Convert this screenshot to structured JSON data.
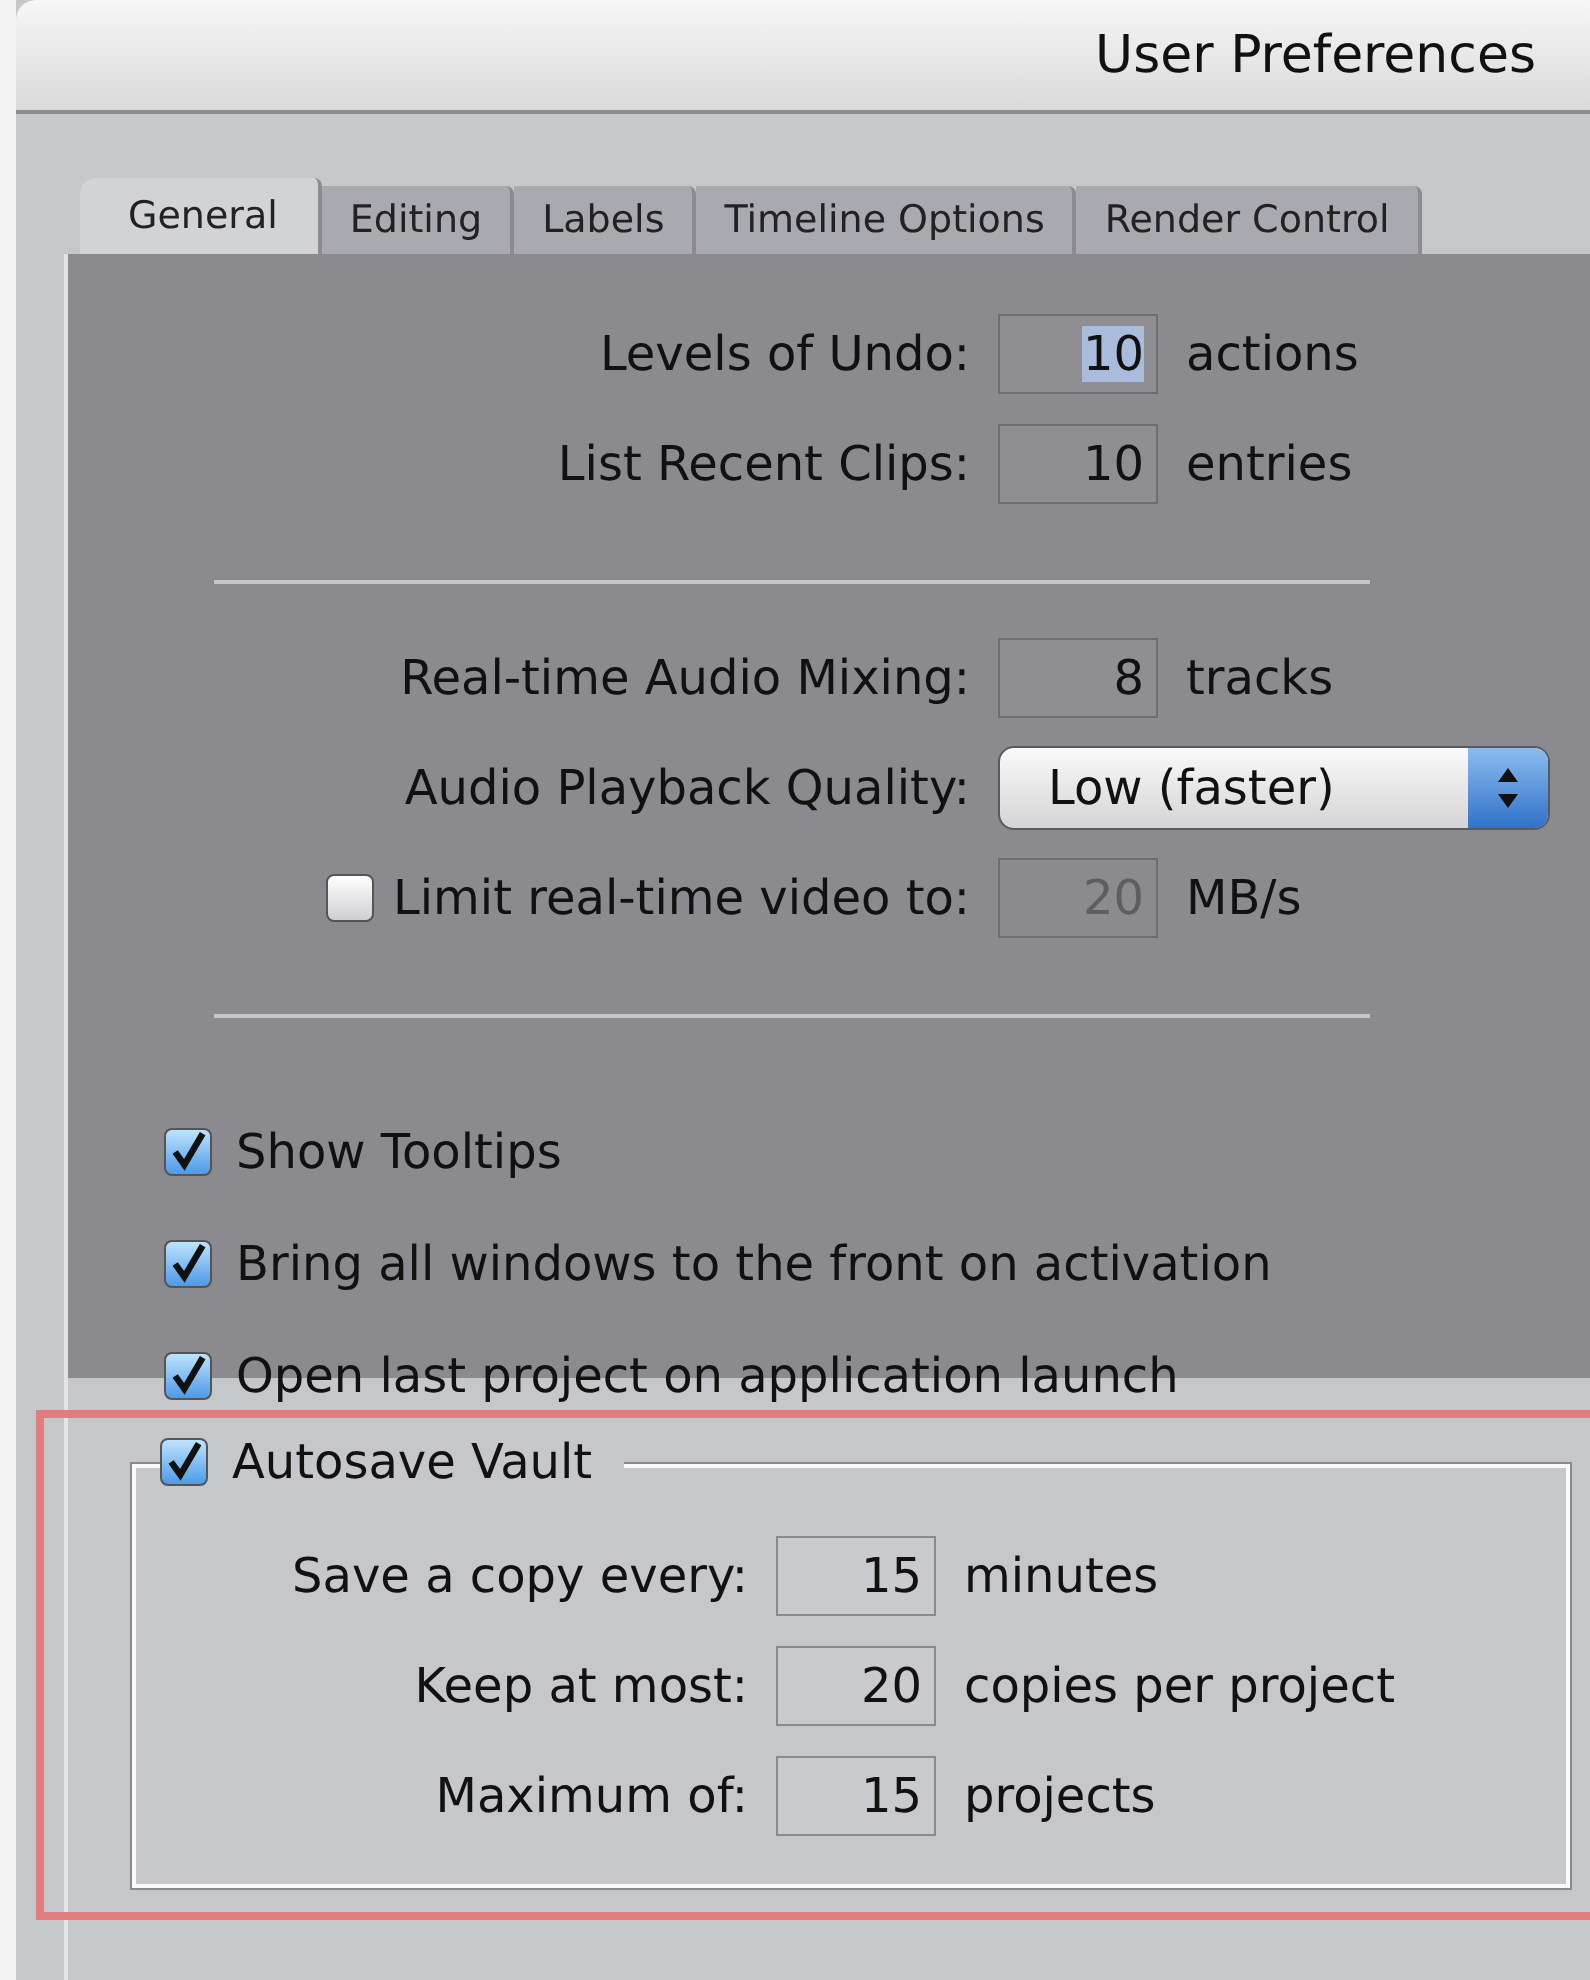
{
  "window": {
    "title": "User Preferences"
  },
  "tabs": [
    {
      "label": "General",
      "selected": true
    },
    {
      "label": "Editing",
      "selected": false
    },
    {
      "label": "Labels",
      "selected": false
    },
    {
      "label": "Timeline Options",
      "selected": false
    },
    {
      "label": "Render Control",
      "selected": false
    }
  ],
  "general": {
    "rows": [
      {
        "kind": "number",
        "label": "Levels of Undo:",
        "value": "10",
        "unit": "actions",
        "text_selected": true
      },
      {
        "kind": "number",
        "label": "List Recent Clips:",
        "value": "10",
        "unit": "entries",
        "text_selected": false
      },
      {
        "kind": "separator"
      },
      {
        "kind": "number",
        "label": "Real-time Audio Mixing:",
        "value": "8",
        "unit": "tracks",
        "text_selected": false
      },
      {
        "kind": "popup",
        "label": "Audio Playback Quality:",
        "value": "Low (faster)"
      },
      {
        "kind": "checkbox_number",
        "label": "Limit real-time video to:",
        "checked": false,
        "value": "20",
        "unit": "MB/s",
        "disabled": true
      },
      {
        "kind": "separator"
      },
      {
        "kind": "checkbox",
        "label": "Show Tooltips",
        "checked": true
      },
      {
        "kind": "checkbox",
        "label": "Bring all windows to the front on activation",
        "checked": true
      },
      {
        "kind": "checkbox",
        "label": "Open last project on application launch",
        "checked": true
      }
    ]
  },
  "autosave_vault": {
    "label": "Autosave Vault",
    "checked": true,
    "rows": [
      {
        "label": "Save a copy every:",
        "value": "15",
        "unit": "minutes"
      },
      {
        "label": "Keep at most:",
        "value": "20",
        "unit": "copies per project"
      },
      {
        "label": "Maximum of:",
        "value": "15",
        "unit": "projects"
      }
    ]
  }
}
